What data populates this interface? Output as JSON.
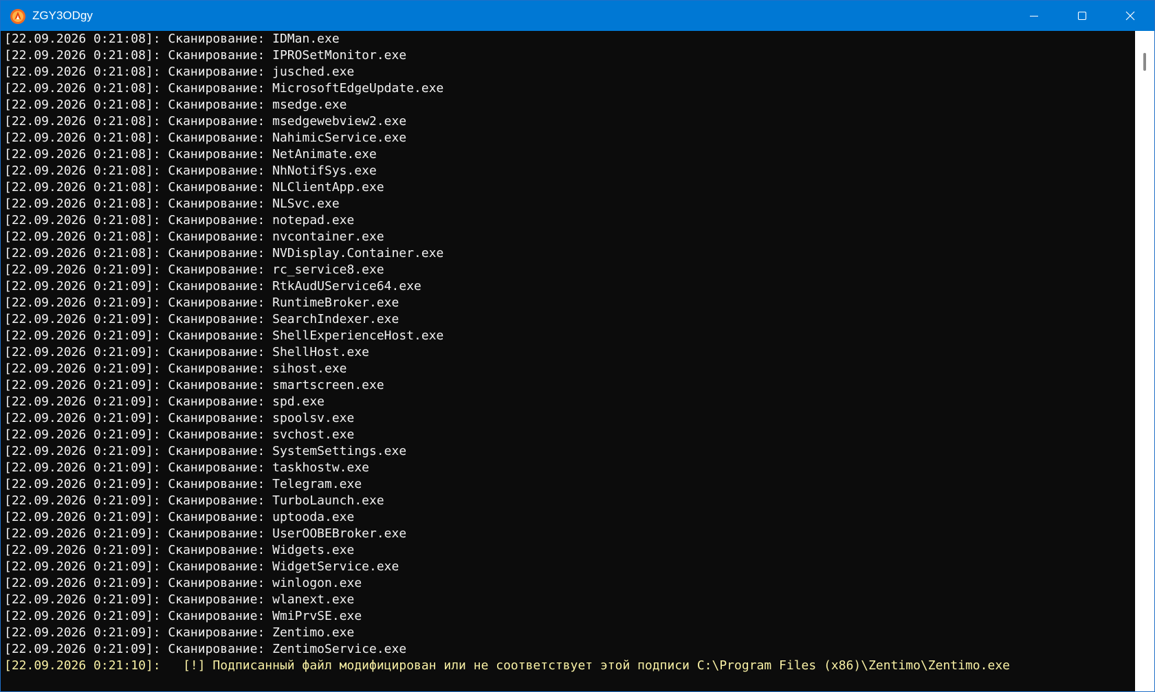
{
  "window": {
    "title": "ZGY3ODgy",
    "icon": "app-logo-icon",
    "controls": [
      "minimize-icon",
      "maximize-icon",
      "close-icon"
    ]
  },
  "colors": {
    "titlebar": "#0078d4",
    "console_bg": "#0c0c0c",
    "text": "#f2f2f2",
    "warning": "#f9f1a5"
  },
  "log": [
    {
      "ts": "[22.09.2026 0:21:08]:",
      "msg": " Сканирование: IDMan.exe"
    },
    {
      "ts": "[22.09.2026 0:21:08]:",
      "msg": " Сканирование: IPROSetMonitor.exe"
    },
    {
      "ts": "[22.09.2026 0:21:08]:",
      "msg": " Сканирование: jusched.exe"
    },
    {
      "ts": "[22.09.2026 0:21:08]:",
      "msg": " Сканирование: MicrosoftEdgeUpdate.exe"
    },
    {
      "ts": "[22.09.2026 0:21:08]:",
      "msg": " Сканирование: msedge.exe"
    },
    {
      "ts": "[22.09.2026 0:21:08]:",
      "msg": " Сканирование: msedgewebview2.exe"
    },
    {
      "ts": "[22.09.2026 0:21:08]:",
      "msg": " Сканирование: NahimicService.exe"
    },
    {
      "ts": "[22.09.2026 0:21:08]:",
      "msg": " Сканирование: NetAnimate.exe"
    },
    {
      "ts": "[22.09.2026 0:21:08]:",
      "msg": " Сканирование: NhNotifSys.exe"
    },
    {
      "ts": "[22.09.2026 0:21:08]:",
      "msg": " Сканирование: NLClientApp.exe"
    },
    {
      "ts": "[22.09.2026 0:21:08]:",
      "msg": " Сканирование: NLSvc.exe"
    },
    {
      "ts": "[22.09.2026 0:21:08]:",
      "msg": " Сканирование: notepad.exe"
    },
    {
      "ts": "[22.09.2026 0:21:08]:",
      "msg": " Сканирование: nvcontainer.exe"
    },
    {
      "ts": "[22.09.2026 0:21:08]:",
      "msg": " Сканирование: NVDisplay.Container.exe"
    },
    {
      "ts": "[22.09.2026 0:21:09]:",
      "msg": " Сканирование: rc_service8.exe"
    },
    {
      "ts": "[22.09.2026 0:21:09]:",
      "msg": " Сканирование: RtkAudUService64.exe"
    },
    {
      "ts": "[22.09.2026 0:21:09]:",
      "msg": " Сканирование: RuntimeBroker.exe"
    },
    {
      "ts": "[22.09.2026 0:21:09]:",
      "msg": " Сканирование: SearchIndexer.exe"
    },
    {
      "ts": "[22.09.2026 0:21:09]:",
      "msg": " Сканирование: ShellExperienceHost.exe"
    },
    {
      "ts": "[22.09.2026 0:21:09]:",
      "msg": " Сканирование: ShellHost.exe"
    },
    {
      "ts": "[22.09.2026 0:21:09]:",
      "msg": " Сканирование: sihost.exe"
    },
    {
      "ts": "[22.09.2026 0:21:09]:",
      "msg": " Сканирование: smartscreen.exe"
    },
    {
      "ts": "[22.09.2026 0:21:09]:",
      "msg": " Сканирование: spd.exe"
    },
    {
      "ts": "[22.09.2026 0:21:09]:",
      "msg": " Сканирование: spoolsv.exe"
    },
    {
      "ts": "[22.09.2026 0:21:09]:",
      "msg": " Сканирование: svchost.exe"
    },
    {
      "ts": "[22.09.2026 0:21:09]:",
      "msg": " Сканирование: SystemSettings.exe"
    },
    {
      "ts": "[22.09.2026 0:21:09]:",
      "msg": " Сканирование: taskhostw.exe"
    },
    {
      "ts": "[22.09.2026 0:21:09]:",
      "msg": " Сканирование: Telegram.exe"
    },
    {
      "ts": "[22.09.2026 0:21:09]:",
      "msg": " Сканирование: TurboLaunch.exe"
    },
    {
      "ts": "[22.09.2026 0:21:09]:",
      "msg": " Сканирование: uptooda.exe"
    },
    {
      "ts": "[22.09.2026 0:21:09]:",
      "msg": " Сканирование: UserOOBEBroker.exe"
    },
    {
      "ts": "[22.09.2026 0:21:09]:",
      "msg": " Сканирование: Widgets.exe"
    },
    {
      "ts": "[22.09.2026 0:21:09]:",
      "msg": " Сканирование: WidgetService.exe"
    },
    {
      "ts": "[22.09.2026 0:21:09]:",
      "msg": " Сканирование: winlogon.exe"
    },
    {
      "ts": "[22.09.2026 0:21:09]:",
      "msg": " Сканирование: wlanext.exe"
    },
    {
      "ts": "[22.09.2026 0:21:09]:",
      "msg": " Сканирование: WmiPrvSE.exe"
    },
    {
      "ts": "[22.09.2026 0:21:09]:",
      "msg": " Сканирование: Zentimo.exe"
    },
    {
      "ts": "[22.09.2026 0:21:09]:",
      "msg": " Сканирование: ZentimoService.exe"
    },
    {
      "ts": "[22.09.2026 0:21:10]:",
      "msg": "   [!] Подписанный файл модифицирован или не соответствует этой подписи C:\\Program Files (x86)\\Zentimo\\Zentimo.exe",
      "level": "warning"
    }
  ]
}
